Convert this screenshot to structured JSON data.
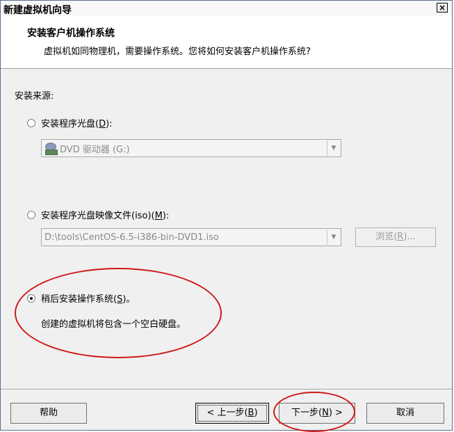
{
  "window": {
    "title": "新建虚拟机向导",
    "close_symbol": "×"
  },
  "header": {
    "title": "安装客户机操作系统",
    "subtitle": "虚拟机如同物理机，需要操作系统。您将如何安装客户机操作系统?"
  },
  "install_source": {
    "label": "安装来源:",
    "disc": {
      "label_prefix": "安装程序光盘(",
      "mnemonic": "D",
      "label_suffix": "):",
      "selected": false,
      "drive_value": "DVD 驱动器 (G:)",
      "drive_icon": "dvd-drive-icon"
    },
    "iso": {
      "label_prefix": "安装程序光盘映像文件(iso)(",
      "mnemonic": "M",
      "label_suffix": "):",
      "selected": false,
      "path_value": "D:\\tools\\CentOS-6.5-i386-bin-DVD1.iso",
      "browse_prefix": "浏览(",
      "browse_mnemonic": "R",
      "browse_suffix": ")..."
    },
    "later": {
      "label_prefix": "稍后安装操作系统(",
      "mnemonic": "S",
      "label_suffix": ")。",
      "selected": true,
      "description": "创建的虚拟机将包含一个空白硬盘。"
    }
  },
  "buttons": {
    "help": "帮助",
    "back_prefix": "< 上一步(",
    "back_mnemonic": "B",
    "back_suffix": ")",
    "next_prefix": "下一步(",
    "next_mnemonic": "N",
    "next_suffix": ") >",
    "cancel": "取消"
  },
  "colors": {
    "annotation": "#d01818"
  }
}
